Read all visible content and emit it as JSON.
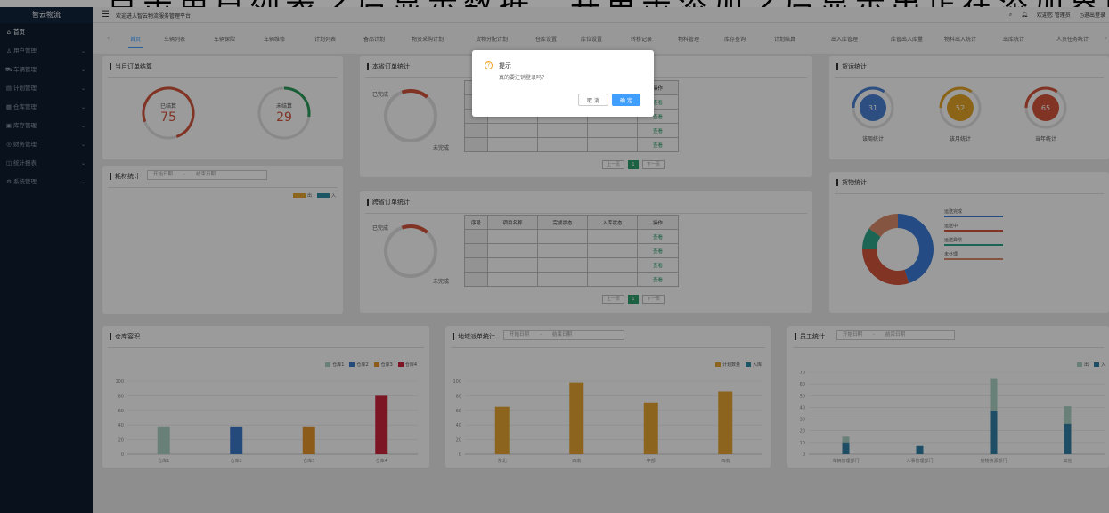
{
  "caption": "点击用户列表之后显示数据，并单击添加之后显示出正在添加界面",
  "sidebar": {
    "logo": "智云物流",
    "items": [
      {
        "icon": "⌂",
        "label": "首页"
      },
      {
        "icon": "♙",
        "label": "用户管理"
      },
      {
        "icon": "⛟",
        "label": "车辆管理"
      },
      {
        "icon": "▤",
        "label": "计划管理"
      },
      {
        "icon": "▦",
        "label": "仓库管理"
      },
      {
        "icon": "▣",
        "label": "库存管理"
      },
      {
        "icon": "◎",
        "label": "财务管理"
      },
      {
        "icon": "◫",
        "label": "统计报表"
      },
      {
        "icon": "⚙",
        "label": "系统管理"
      }
    ]
  },
  "topbar": {
    "welcome": "欢迎进入智云物流服务管理平台",
    "search_icon": "⌕",
    "bell_icon": "♫",
    "user_text": "欢迎您 管理员",
    "logout_text": "◷退出登录"
  },
  "tabs": [
    "首页",
    "车辆列表",
    "车辆保险",
    "车辆维修",
    "计划列表",
    "备品计划",
    "物资采购计划",
    "货物分配计划",
    "仓库设置",
    "库位设置",
    "转移记录",
    "物料管理",
    "库存查询",
    "计划结算",
    "出入库管理",
    "库管出入库量",
    "物料出入统计",
    "出库统计",
    "人员任务统计"
  ],
  "month_order": {
    "title": "当月订单结算",
    "settled_label": "已结算",
    "settled_value": "75",
    "unsettled_label": "未结算",
    "unsettled_value": "29"
  },
  "material": {
    "title": "耗材统计",
    "start_placeholder": "开始日期",
    "end_placeholder": "结束日期",
    "legend": [
      "出",
      "入"
    ]
  },
  "this_month_orders": {
    "title": "本省订单统计",
    "done_label": "已完成",
    "undone_label": "未完成",
    "op_label": "查看",
    "col_op": "操作",
    "prev": "上一页",
    "page": "1",
    "next": "下一页"
  },
  "cross_orders": {
    "title": "跨省订单统计",
    "done_label": "已完成",
    "undone_label": "未完成",
    "columns": [
      "序号",
      "项目名称",
      "完成状态",
      "入库状态",
      "操作"
    ],
    "op_label": "查看",
    "prev": "上一页",
    "page": "1",
    "next": "下一页"
  },
  "freight": {
    "title": "货运统计",
    "items": [
      {
        "value": "31",
        "label": "该周统计",
        "color": "#4a7fd0"
      },
      {
        "value": "52",
        "label": "该月统计",
        "color": "#e3a227"
      },
      {
        "value": "65",
        "label": "当年统计",
        "color": "#d0533b"
      }
    ]
  },
  "goods": {
    "title": "货物统计",
    "legend": [
      "运送完成",
      "运送中",
      "运送异常",
      "未处理"
    ],
    "legend_colors": [
      "#3b7ad3",
      "#d0533b",
      "#2ea38a",
      "#d88a6a"
    ],
    "segments": [
      {
        "value": 45,
        "color": "#3b7ad3"
      },
      {
        "value": 30,
        "color": "#d0533b"
      },
      {
        "value": 10,
        "color": "#2ea38a"
      },
      {
        "value": 15,
        "color": "#d88a6a"
      }
    ]
  },
  "warehouse": {
    "title": "仓库容积",
    "legend": [
      "仓库1",
      "仓库2",
      "仓库3",
      "仓库4"
    ],
    "colors": [
      "#a9cfc2",
      "#3b78c8",
      "#e3942b",
      "#c8253b"
    ]
  },
  "region": {
    "title": "地域派单统计",
    "start_placeholder": "开始日期",
    "end_placeholder": "结束日期",
    "legend": [
      "计划数量",
      "入库"
    ],
    "colors": [
      "#e3a230",
      "#2e8aa0"
    ]
  },
  "staff": {
    "title": "员工统计",
    "start_placeholder": "开始日期",
    "end_placeholder": "结束日期",
    "legend": [
      "出",
      "入"
    ],
    "colors": [
      "#a9cfc2",
      "#2f7fa5"
    ]
  },
  "dialog": {
    "title": "提示",
    "message": "真的要注销登录吗？",
    "cancel": "取 消",
    "ok": "确 定",
    "icon": "?"
  },
  "chart_data": [
    {
      "type": "bar",
      "title": "仓库容积",
      "categories": [
        "仓库1",
        "仓库2",
        "仓库3",
        "仓库4"
      ],
      "series": [
        {
          "name": "仓库1",
          "values": [
            38,
            0,
            0,
            0
          ]
        },
        {
          "name": "仓库2",
          "values": [
            0,
            38,
            0,
            0
          ]
        },
        {
          "name": "仓库3",
          "values": [
            0,
            0,
            38,
            0
          ]
        },
        {
          "name": "仓库4",
          "values": [
            0,
            0,
            0,
            80
          ]
        }
      ],
      "ylim": [
        0,
        100
      ],
      "yticks": [
        0,
        20,
        40,
        60,
        80,
        100
      ]
    },
    {
      "type": "bar",
      "title": "地域派单统计",
      "categories": [
        "东北",
        "西南",
        "中部",
        "西南"
      ],
      "series": [
        {
          "name": "计划数量",
          "values": [
            65,
            98,
            71,
            86
          ]
        },
        {
          "name": "入库",
          "values": [
            0,
            0,
            0,
            0
          ]
        }
      ],
      "ylim": [
        0,
        100
      ],
      "yticks": [
        0,
        20,
        40,
        60,
        80,
        100
      ]
    },
    {
      "type": "bar",
      "title": "员工统计",
      "categories": [
        "车辆管理部门",
        "人事管理部门",
        "货物资源部门",
        "其他"
      ],
      "series": [
        {
          "name": "出",
          "values": [
            15,
            7,
            65,
            41
          ]
        },
        {
          "name": "入",
          "values": [
            10,
            7,
            37,
            26
          ]
        }
      ],
      "ylim": [
        0,
        70
      ],
      "yticks": [
        0,
        10,
        20,
        30,
        40,
        50,
        60,
        70
      ]
    }
  ]
}
